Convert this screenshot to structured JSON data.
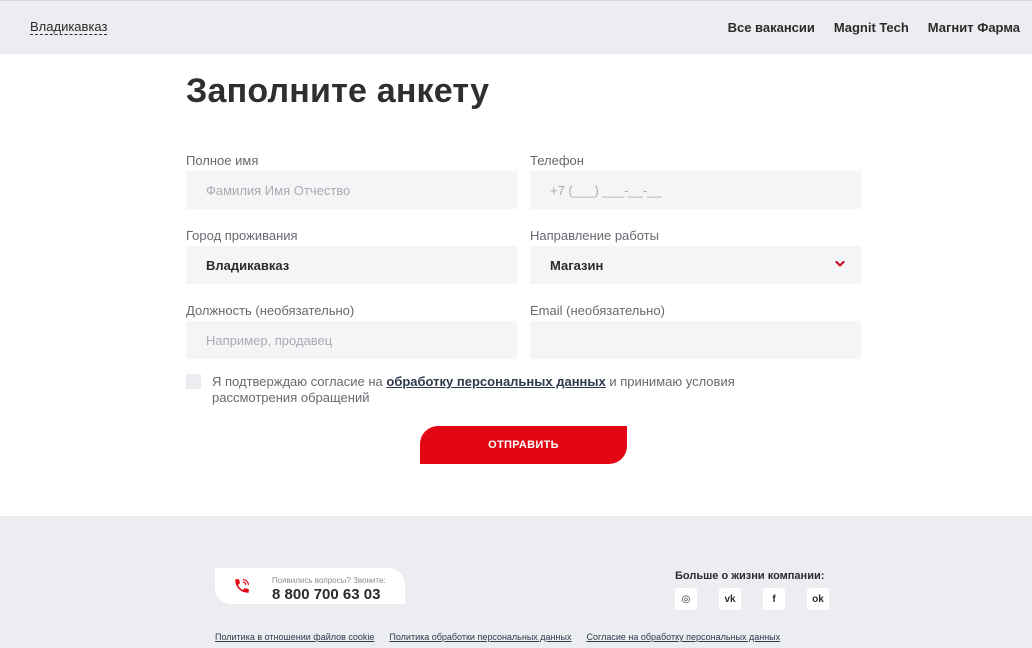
{
  "header": {
    "city": "Владикавказ",
    "nav": [
      "Все вакансии",
      "Magnit Tech",
      "Магнит Фарма"
    ]
  },
  "form": {
    "title": "Заполните анкету",
    "full_name": {
      "label": "Полное имя",
      "placeholder": "Фамилия Имя Отчество",
      "value": ""
    },
    "phone": {
      "label": "Телефон",
      "placeholder": "+7 (___) ___-__-__",
      "value": ""
    },
    "city": {
      "label": "Город проживания",
      "value": "Владикавказ"
    },
    "direction": {
      "label": "Направление работы",
      "value": "Магазин",
      "icon": "chevron-down-icon"
    },
    "position": {
      "label": "Должность (необязательно)",
      "placeholder": "Например, продавец",
      "value": ""
    },
    "email": {
      "label": "Email (необязательно)",
      "placeholder": "",
      "value": ""
    },
    "consent": {
      "checked": false,
      "text_before": "Я подтверждаю согласие на ",
      "link": "обработку персональных данных",
      "text_after": " и принимаю условия рассмотрения обращений"
    },
    "submit_label": "ОТПРАВИТЬ"
  },
  "footer": {
    "phone_question": "Появились вопросы? Звоните:",
    "phone_number": "8 800 700 63 03",
    "phone_icon": "phone-icon",
    "more_label": "Больше о жизни компании:",
    "socials": [
      {
        "name": "instagram-icon",
        "glyph": "◎"
      },
      {
        "name": "vk-icon",
        "glyph": "vk"
      },
      {
        "name": "facebook-icon",
        "glyph": "f"
      },
      {
        "name": "odnoklassniki-icon",
        "glyph": "ok"
      }
    ],
    "links": [
      "Политика в отношении файлов cookie",
      "Политика обработки персональных данных",
      "Согласие на обработку персональных данных"
    ]
  },
  "colors": {
    "accent": "#e30613",
    "header_bg": "#ecedf0",
    "field_bg": "#f5f5f7"
  }
}
